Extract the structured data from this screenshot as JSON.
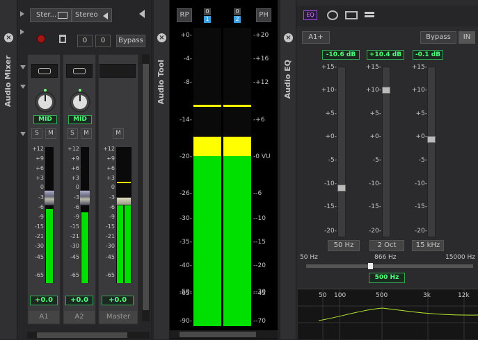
{
  "mixer": {
    "tab_label": "Audio Mixer",
    "top_row": [
      {
        "label": "Ster...",
        "icon": "keyboard-icon"
      },
      {
        "label": "Stereo",
        "icon": "speaker-icon"
      }
    ],
    "controls": {
      "count_a": "0",
      "count_b": "0",
      "bypass": "Bypass"
    },
    "channels": [
      {
        "name": "A1",
        "pan": "MID",
        "solo": "S",
        "mute": "M",
        "gain": "+0.0",
        "level": 0.65
      },
      {
        "name": "A2",
        "pan": "MID",
        "solo": "S",
        "mute": "M",
        "gain": "+0.0",
        "level": 0.55
      },
      {
        "name": "Master",
        "mute": "M",
        "gain": "+0.0",
        "level": 0.6
      }
    ],
    "scale": [
      "+12",
      "+9",
      "+6",
      "+3",
      "0",
      "-3",
      "-6",
      "-9",
      "-15",
      "-21",
      "-30",
      "-45",
      "-65"
    ]
  },
  "tool": {
    "tab_label": "Audio Tool",
    "rp": "RP",
    "ph": "PH",
    "ch1_top": "0",
    "ch1_num": "1",
    "ch2_top": "0",
    "ch2_num": "2",
    "left_scale": [
      "+0",
      "-4",
      "-8",
      "-14",
      "-20",
      "-26",
      "-30",
      "-35",
      "-40",
      "-50",
      "-65",
      "-90"
    ],
    "right_scale": [
      "+20",
      "+16",
      "+12",
      "+6",
      "0 VU",
      "-6",
      "-10",
      "-15",
      "-20",
      "-30",
      "-45",
      "-70"
    ],
    "colors": {
      "green": "#00e000",
      "yellow": "#ffff00"
    }
  },
  "eq": {
    "tab_label": "Audio EQ",
    "icon_labels": [
      "EQ"
    ],
    "preset": "A1+",
    "bypass": "Bypass",
    "in": "IN",
    "bands": [
      {
        "value": "-10.6 dB",
        "label": "50 Hz",
        "level": -10.6
      },
      {
        "value": "+10.4 dB",
        "label": "2 Oct",
        "level": 10.4
      },
      {
        "value": "-0.1 dB",
        "label": "15 kHz",
        "level": -0.1
      }
    ],
    "scale": [
      "+15",
      "+10",
      "+5",
      "+0",
      "-5",
      "-10",
      "-15",
      "-20"
    ],
    "freq_min": "50 Hz",
    "freq_mid": "866 Hz",
    "freq_max": "15000 Hz",
    "freq_value": "500 Hz",
    "graph_labels": [
      "50",
      "100",
      "500",
      "3k",
      "12k"
    ]
  }
}
